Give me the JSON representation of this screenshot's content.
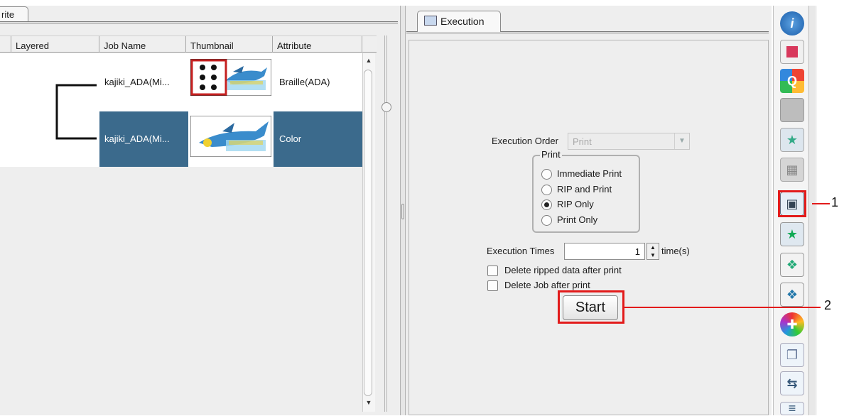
{
  "left": {
    "tab_label": "rite",
    "columns": [
      "Layered",
      "Job Name",
      "Thumbnail",
      "Attribute"
    ],
    "rows": [
      {
        "job_name": "kajiki_ADA(Mi...",
        "attribute": "Braille(ADA)"
      },
      {
        "job_name": "kajiki_ADA(Mi...",
        "attribute": "Color"
      }
    ]
  },
  "right": {
    "tab_label": "Execution",
    "execution_order_label": "Execution Order",
    "execution_order_value": "Print",
    "print_group_title": "Print",
    "radio_options": [
      "Immediate Print",
      "RIP and Print",
      "RIP Only",
      "Print Only"
    ],
    "selected_option": "RIP Only",
    "execution_times_label": "Execution Times",
    "execution_times_value": "1",
    "execution_times_unit": "time(s)",
    "checkboxes": [
      "Delete ripped data after print",
      "Delete Job after print"
    ],
    "start_label": "Start"
  },
  "callouts": {
    "one": "1",
    "two": "2"
  },
  "colors": {
    "selection": "#3b6a8c",
    "highlight": "#e21b1b"
  },
  "toolbar_icons": [
    "info-icon",
    "favorite-add-icon",
    "q-icon",
    "blank-tool-icon",
    "printer-star-icon",
    "printer-grid-icon",
    "execution-icon",
    "copy-star-icon",
    "layer-down-icon",
    "layer-arrows-icon",
    "color-wheel-icon",
    "duplicate-icon",
    "swap-icon",
    "menu-icon"
  ]
}
